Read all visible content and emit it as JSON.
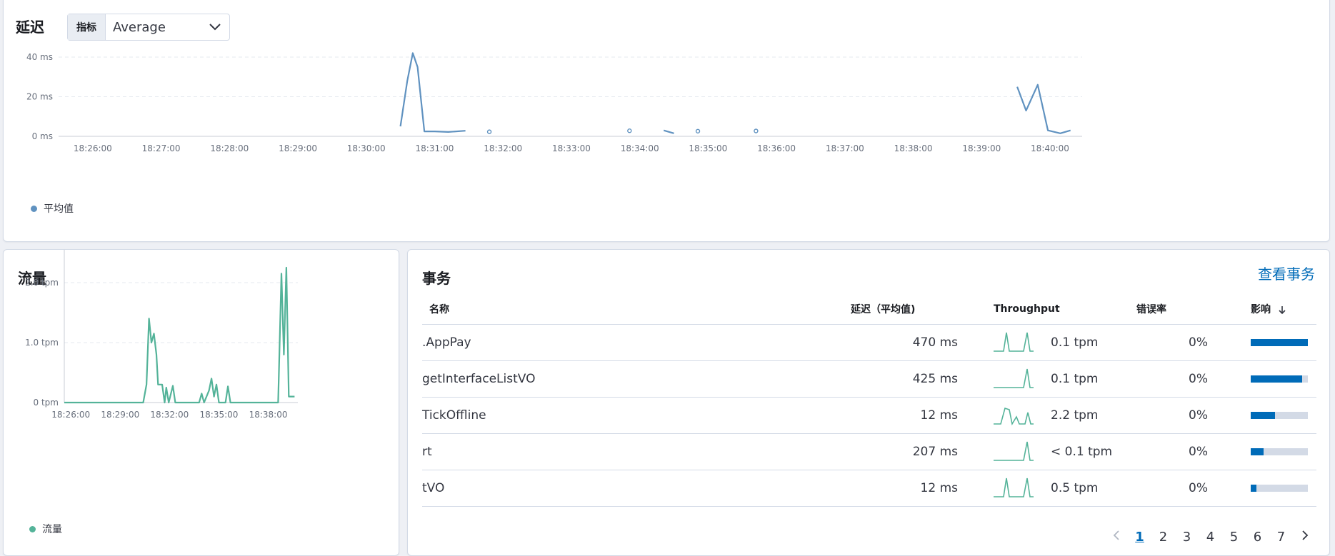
{
  "latency": {
    "title": "延迟",
    "metric_label": "指标",
    "metric_value": "Average",
    "legend": "平均值",
    "line_color": "#6092c0"
  },
  "throughput": {
    "title": "流量",
    "legend": "流量",
    "line_color": "#54b399"
  },
  "transactions": {
    "title": "事务",
    "view_link": "查看事务",
    "columns": [
      "名称",
      "延迟（平均值)",
      "Throughput",
      "错误率",
      "影响"
    ],
    "sort_icon": "arrow-down-icon",
    "rows": [
      {
        "name": ".AppPay",
        "latency": "470 ms",
        "throughput": "0.1 tpm",
        "error_rate": "0%",
        "impact": 100
      },
      {
        "name": "getInterfaceListVO",
        "latency": "425 ms",
        "throughput": "0.1 tpm",
        "error_rate": "0%",
        "impact": 90
      },
      {
        "name": "TickOffline",
        "latency": "12 ms",
        "throughput": "2.2 tpm",
        "error_rate": "0%",
        "impact": 42
      },
      {
        "name": "rt",
        "latency": "207 ms",
        "throughput": "< 0.1 tpm",
        "error_rate": "0%",
        "impact": 22
      },
      {
        "name": "tVO",
        "latency": "12 ms",
        "throughput": "0.5 tpm",
        "error_rate": "0%",
        "impact": 10
      }
    ],
    "pagination": {
      "prev_icon": "chevron-left-icon",
      "next_icon": "chevron-right-icon",
      "pages": [
        "1",
        "2",
        "3",
        "4",
        "5",
        "6",
        "7"
      ],
      "current": "1"
    }
  },
  "chart_data": [
    {
      "type": "line",
      "title": "延迟",
      "x_ticks": [
        "18:26:00",
        "18:27:00",
        "18:28:00",
        "18:29:00",
        "18:30:00",
        "18:31:00",
        "18:32:00",
        "18:33:00",
        "18:34:00",
        "18:35:00",
        "18:36:00",
        "18:37:00",
        "18:38:00",
        "18:39:00",
        "18:40:00"
      ],
      "y_ticks": [
        "0 ms",
        "20 ms",
        "40 ms"
      ],
      "ylim": [
        0,
        40
      ],
      "grid": true,
      "series": [
        {
          "name": "平均值",
          "color": "#6092c0",
          "segments": [
            [
              [
                30.5,
                5
              ],
              [
                30.6,
                28
              ],
              [
                30.68,
                42
              ],
              [
                30.75,
                35
              ],
              [
                30.85,
                2.5
              ],
              [
                31.0,
                2.5
              ],
              [
                31.2,
                2.2
              ],
              [
                31.45,
                2.8
              ]
            ],
            [
              [
                34.35,
                3
              ],
              [
                34.5,
                1.5
              ]
            ],
            [
              [
                39.52,
                25
              ],
              [
                39.65,
                13
              ],
              [
                39.82,
                26
              ],
              [
                39.97,
                3
              ],
              [
                40.15,
                1.5
              ],
              [
                40.3,
                3
              ]
            ]
          ],
          "points": [
            [
              31.8,
              2.3
            ],
            [
              33.85,
              2.8
            ],
            [
              34.85,
              2.6
            ],
            [
              35.7,
              2.7
            ]
          ]
        }
      ],
      "x_range": [
        25.5,
        40.47
      ]
    },
    {
      "type": "line",
      "title": "流量",
      "x_ticks": [
        "18:26:00",
        "18:29:00",
        "18:32:00",
        "18:35:00",
        "18:38:00"
      ],
      "y_ticks": [
        "0 tpm",
        "1.0 tpm",
        "2.0 tpm"
      ],
      "ylim": [
        0,
        2.25
      ],
      "grid": true,
      "series": [
        {
          "name": "流量",
          "color": "#54b399",
          "segments": [
            [
              [
                25.6,
                0
              ],
              [
                30.4,
                0
              ],
              [
                30.6,
                0.3
              ],
              [
                30.75,
                1.4
              ],
              [
                30.9,
                1.0
              ],
              [
                31.05,
                1.15
              ],
              [
                31.2,
                0.8
              ],
              [
                31.3,
                0.3
              ],
              [
                31.55,
                0.3
              ],
              [
                31.7,
                0
              ],
              [
                31.8,
                0.25
              ],
              [
                31.95,
                0
              ],
              [
                32.2,
                0.28
              ],
              [
                32.35,
                0
              ],
              [
                33.8,
                0
              ],
              [
                33.95,
                0.15
              ],
              [
                34.1,
                0
              ],
              [
                34.4,
                0.2
              ],
              [
                34.55,
                0.4
              ],
              [
                34.7,
                0.1
              ],
              [
                34.85,
                0.3
              ],
              [
                35.0,
                0
              ],
              [
                35.4,
                0
              ],
              [
                35.55,
                0.27
              ],
              [
                35.7,
                0
              ],
              [
                38.6,
                0
              ],
              [
                38.8,
                2.15
              ],
              [
                38.95,
                0.8
              ],
              [
                39.1,
                2.25
              ],
              [
                39.25,
                0.1
              ],
              [
                39.6,
                0.1
              ]
            ]
          ]
        }
      ],
      "x_range": [
        25.6,
        39.8
      ]
    }
  ]
}
